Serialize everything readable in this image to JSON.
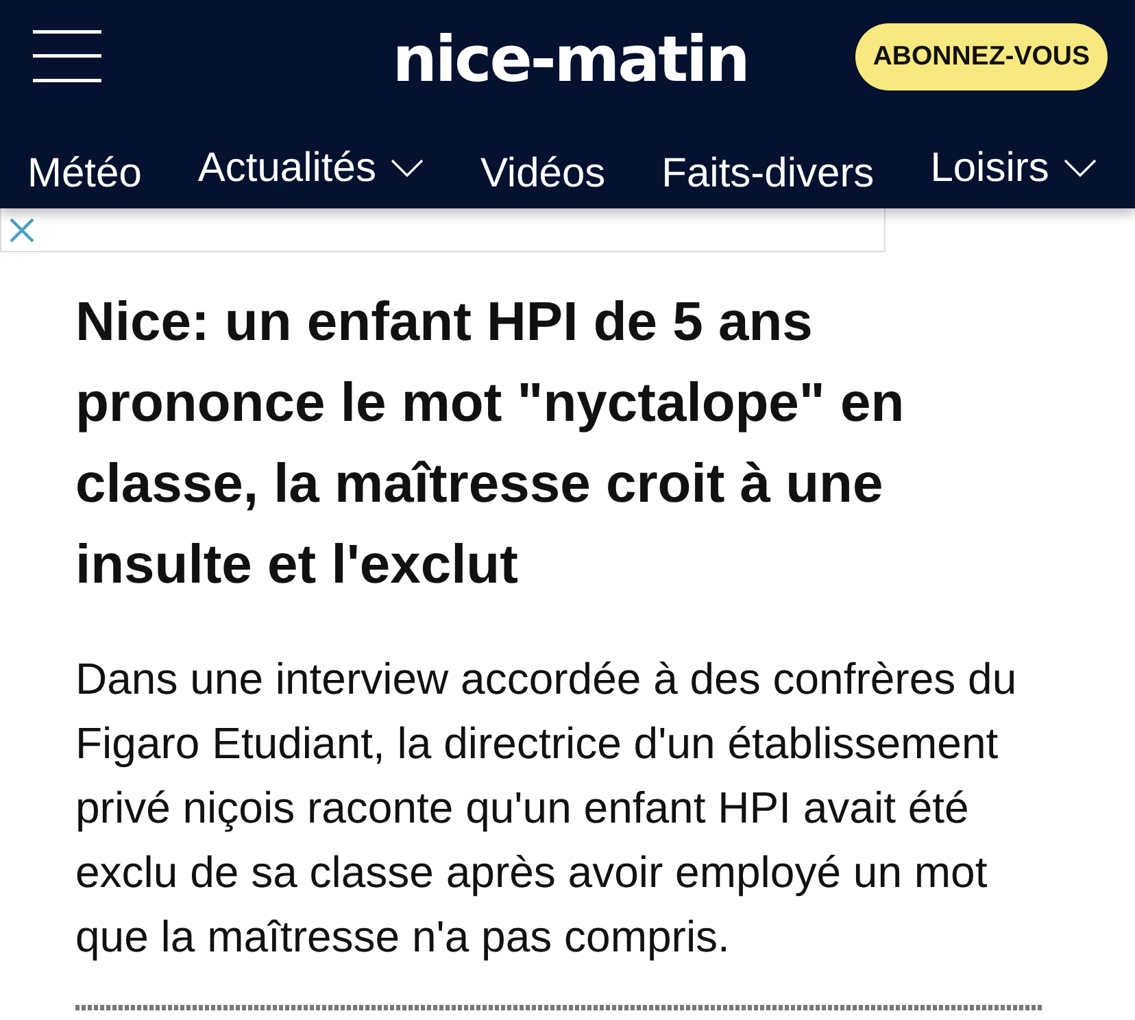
{
  "header": {
    "logo": "nice-matin",
    "subscribe_button": "ABONNEZ-VOUS"
  },
  "nav": {
    "items": [
      {
        "label": "Météo",
        "has_dropdown": false
      },
      {
        "label": "Actualités",
        "has_dropdown": true
      },
      {
        "label": "Vidéos",
        "has_dropdown": false
      },
      {
        "label": "Faits-divers",
        "has_dropdown": false
      },
      {
        "label": "Loisirs",
        "has_dropdown": true
      }
    ]
  },
  "ad_banner": {
    "closable": true
  },
  "article": {
    "title": "Nice: un enfant HPI de 5 ans prononce le mot \"nyctalope\" en classe, la maîtresse croit à une insulte et l'exclut",
    "summary": "Dans une interview accordée à des confrères du Figaro Etudiant, la directrice d'un établissement privé niçois raconte qu'un enfant HPI avait été exclu de sa classe après avoir employé un mot que la maîtresse n'a pas compris."
  }
}
